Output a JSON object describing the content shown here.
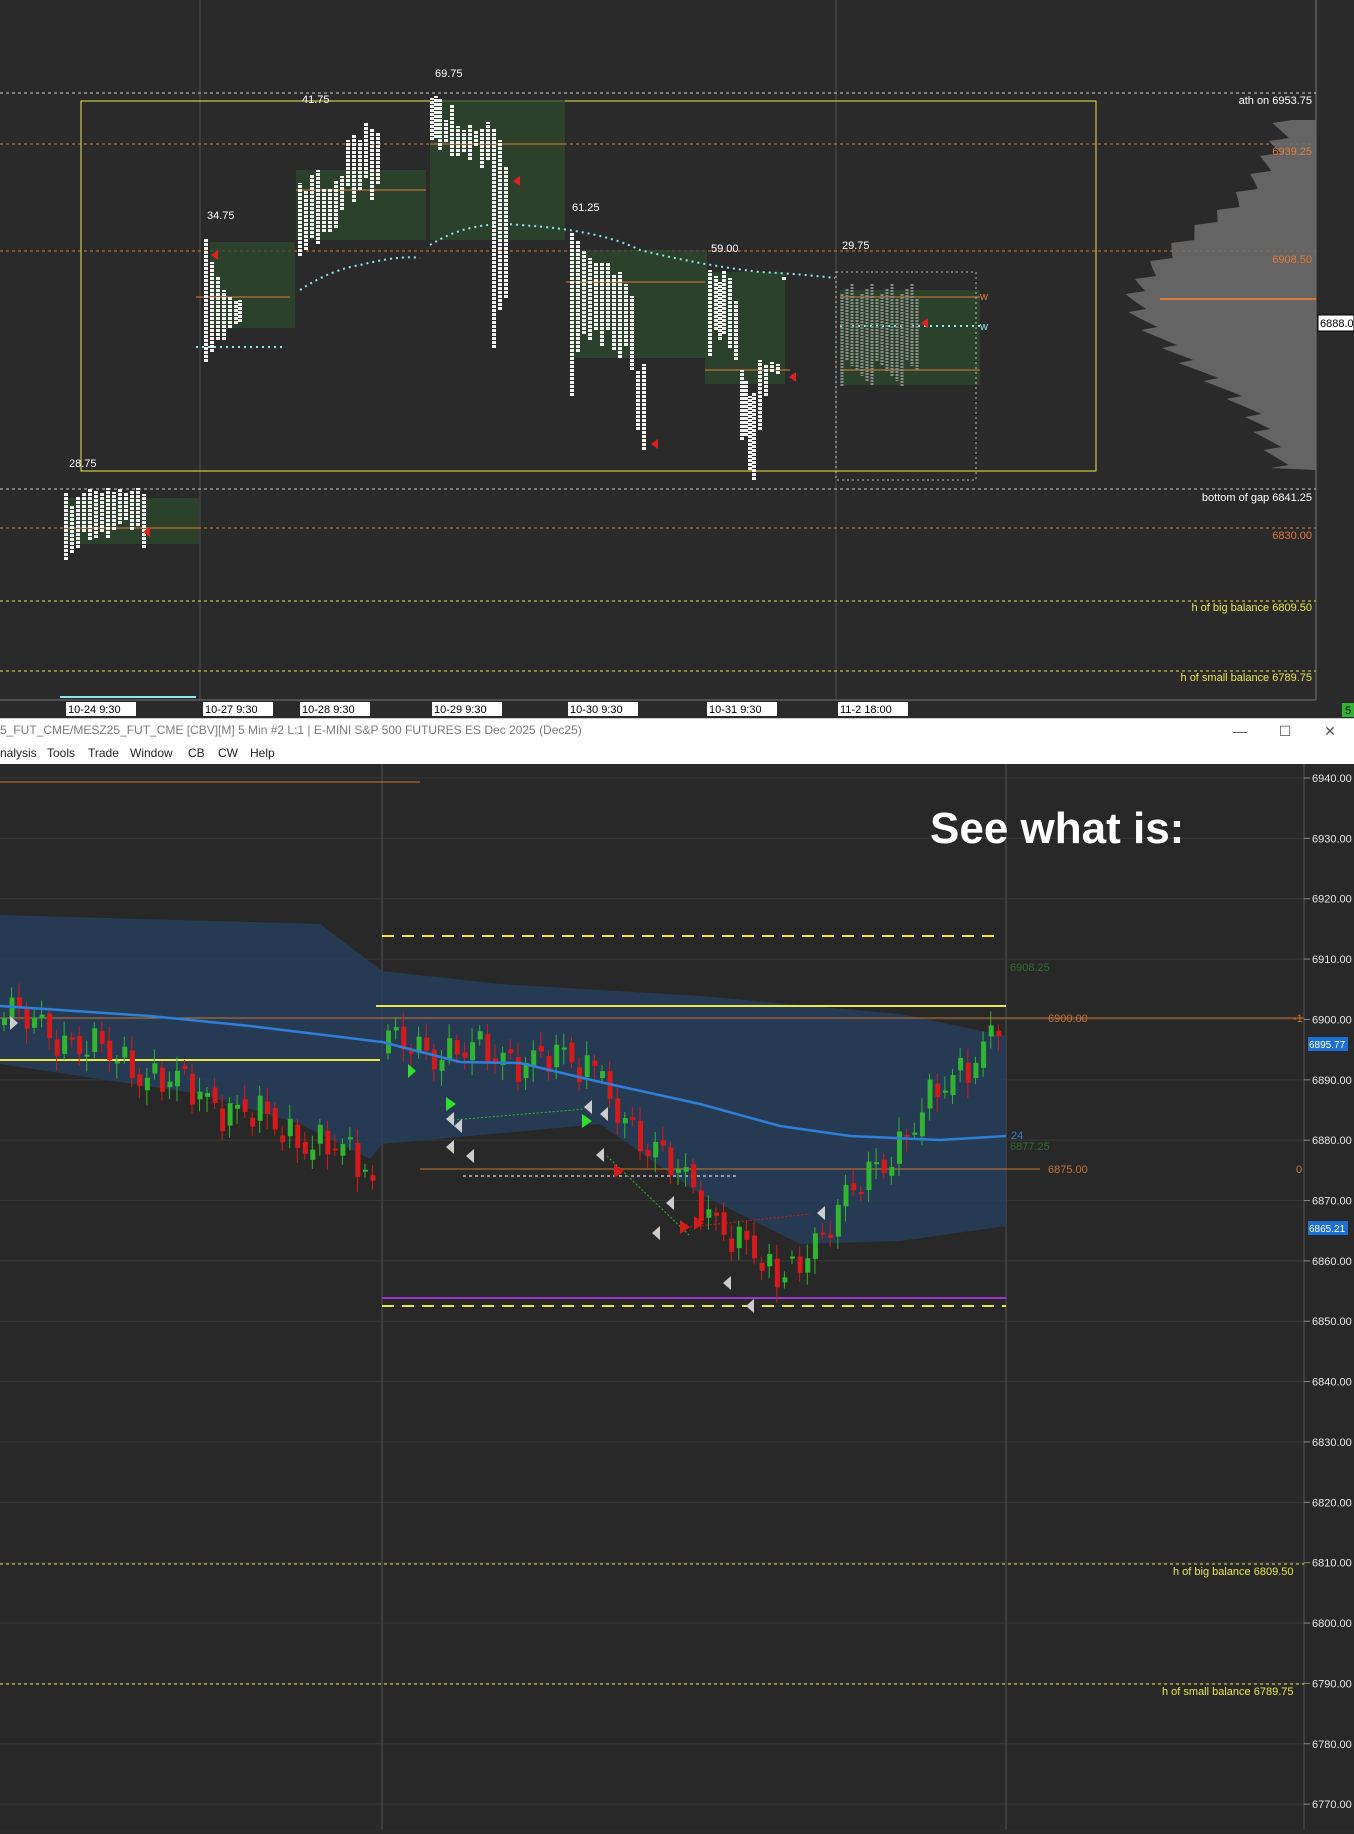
{
  "top_chart": {
    "level_labels": [
      {
        "text": "ath on",
        "value": "6953.75",
        "color": "#ffffff"
      },
      {
        "text": "",
        "value": "6939.25",
        "color": "#e07a3a"
      },
      {
        "text": "",
        "value": "6908.50",
        "color": "#e07a3a"
      },
      {
        "text": "bottom of gap",
        "value": "6841.25",
        "color": "#ffffff"
      },
      {
        "text": "",
        "value": "6830.00",
        "color": "#e07a3a"
      },
      {
        "text": "h of big balance",
        "value": "6809.50",
        "color": "#e8e84a"
      },
      {
        "text": "h of small balance",
        "value": "6789.75",
        "color": "#e8e84a"
      }
    ],
    "price_marker": "6888.0",
    "range_labels": [
      "69.75",
      "41.75",
      "34.75",
      "61.25",
      "59.00",
      "29.75",
      "28.75"
    ],
    "date_labels": [
      "10-24  9:30",
      "10-27  9:30",
      "10-28  9:30",
      "10-29  9:30",
      "10-30  9:30",
      "10-31  9:30",
      "11-2  18:00"
    ],
    "corner_badge": "5",
    "w_labels": [
      "w",
      "w"
    ]
  },
  "window": {
    "title": "5_FUT_CME/MESZ25_FUT_CME [CBV][M]  5 Min  #2 L:1 | E-MINI S&P 500 FUTURES ES Dec 2025 (Dec25)",
    "minimize": "—",
    "maximize": "☐",
    "close": "✕"
  },
  "menu": [
    "nalysis",
    "Tools",
    "Trade",
    "Window",
    "CB",
    "CW",
    "Help"
  ],
  "bottom_chart": {
    "overlay_text": "See what is:",
    "price_axis": [
      "6940.00",
      "6930.00",
      "6920.00",
      "6910.00",
      "6900.00",
      "6890.00",
      "6880.00",
      "6870.00",
      "6860.00",
      "6850.00",
      "6840.00",
      "6830.00",
      "6820.00",
      "6810.00",
      "6800.00",
      "6790.00",
      "6780.00",
      "6770.00"
    ],
    "level_labels": [
      {
        "text": "",
        "value": "6900.00",
        "color": "#c8742e"
      },
      {
        "text": "",
        "value": "6875.00",
        "color": "#c8742e"
      },
      {
        "text": "h of big balance",
        "value": "6809.50",
        "color": "#e8e84a"
      },
      {
        "text": "h of small balance",
        "value": "6789.75",
        "color": "#e8e84a"
      }
    ],
    "badge_blue_1": "6895.77",
    "badge_blue_2": "6865.21",
    "faint_label_1": "6908.25",
    "faint_label_2": "6877.25",
    "vwap_count": "24",
    "side_mark_1": "-1",
    "side_mark_2": "0"
  },
  "colors": {
    "up_candle": "#2fb52f",
    "down_candle": "#d61a1a",
    "vwap": "#2f7fd8",
    "band": "#25405e",
    "level_yellow": "#e8e84a",
    "level_orange": "#c8742e"
  }
}
